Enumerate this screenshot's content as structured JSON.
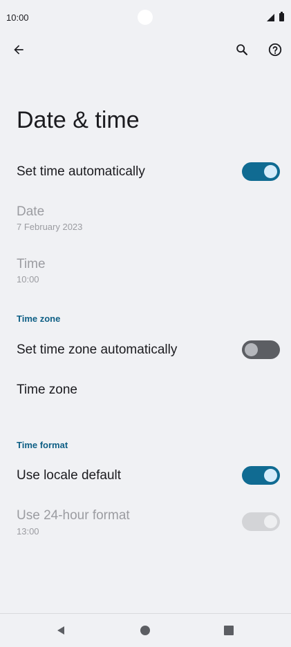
{
  "status_bar": {
    "time": "10:00"
  },
  "toolbar": {
    "back_icon": "arrow-back-icon",
    "search_icon": "search-icon",
    "help_icon": "help-icon"
  },
  "page": {
    "title": "Date & time"
  },
  "settings": {
    "set_time_auto": {
      "label": "Set time automatically",
      "enabled": true
    },
    "date": {
      "label": "Date",
      "value": "7 February 2023"
    },
    "time": {
      "label": "Time",
      "value": "10:00"
    },
    "time_zone_section": {
      "header": "Time zone"
    },
    "set_time_zone_auto": {
      "label": "Set time zone automatically",
      "enabled": false
    },
    "time_zone": {
      "label": "Time zone"
    },
    "time_format_section": {
      "header": "Time format"
    },
    "use_locale_default": {
      "label": "Use locale default",
      "enabled": true
    },
    "use_24_hour": {
      "label": "Use 24-hour format",
      "value": "13:00",
      "enabled": true
    }
  },
  "colors": {
    "accent": "#106b92",
    "section_header": "#0e5f85",
    "disabled_text": "#9b9ca1",
    "background": "#f0f1f4"
  },
  "nav_bar": {
    "back": "triangle-back-icon",
    "home": "circle-home-icon",
    "recents": "square-recents-icon"
  }
}
